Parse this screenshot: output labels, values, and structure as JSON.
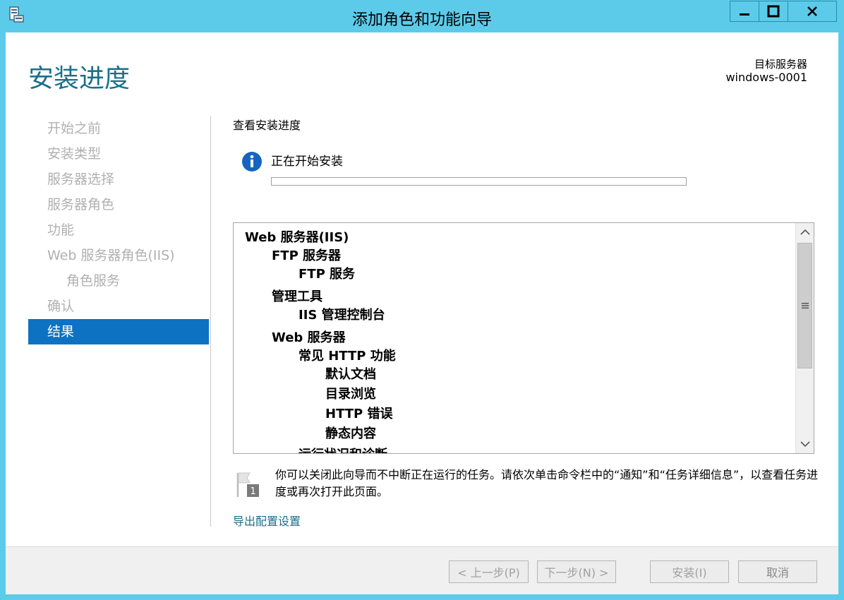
{
  "window": {
    "title": "添加角色和功能向导"
  },
  "header": {
    "page_title": "安装进度",
    "target_label": "目标服务器",
    "target_name": "windows-0001"
  },
  "nav": {
    "items": [
      {
        "label": "开始之前",
        "state": "disabled"
      },
      {
        "label": "安装类型",
        "state": "disabled"
      },
      {
        "label": "服务器选择",
        "state": "disabled"
      },
      {
        "label": "服务器角色",
        "state": "disabled"
      },
      {
        "label": "功能",
        "state": "disabled"
      },
      {
        "label": "Web 服务器角色(IIS)",
        "state": "disabled"
      },
      {
        "label": "角色服务",
        "state": "disabled",
        "sub": true
      },
      {
        "label": "确认",
        "state": "disabled"
      },
      {
        "label": "结果",
        "state": "active"
      }
    ]
  },
  "main": {
    "section_title": "查看安装进度",
    "status_text": "正在开始安装",
    "progress_fraction": 0.0,
    "results_tree": [
      {
        "label": "Web 服务器(IIS)",
        "level": 0
      },
      {
        "label": "FTP 服务器",
        "level": 1
      },
      {
        "label": "FTP 服务",
        "level": 2
      },
      {
        "label": "管理工具",
        "level": 1
      },
      {
        "label": "IIS 管理控制台",
        "level": 2
      },
      {
        "label": "Web 服务器",
        "level": 1
      },
      {
        "label": "常见 HTTP 功能",
        "level": 2
      },
      {
        "label": "默认文档",
        "level": 3
      },
      {
        "label": "目录浏览",
        "level": 3
      },
      {
        "label": "HTTP 错误",
        "level": 3
      },
      {
        "label": "静态内容",
        "level": 3
      },
      {
        "label": "运行状况和诊断",
        "level": 2
      }
    ],
    "notice_text": "你可以关闭此向导而不中断正在运行的任务。请依次单击命令栏中的“通知”和“任务详细信息”，以查看任务进度或再次打开此页面。",
    "notice_badge": "1",
    "export_link": "导出配置设置"
  },
  "footer": {
    "prev_label": "< 上一步(P)",
    "next_label": "下一步(N) >",
    "install_label": "安装(I)",
    "cancel_label": "取消"
  },
  "colors": {
    "frame": "#5ccbea",
    "accent": "#0e72c2",
    "heading": "#1a6f8a",
    "disabled_text": "#b0b0b0"
  }
}
